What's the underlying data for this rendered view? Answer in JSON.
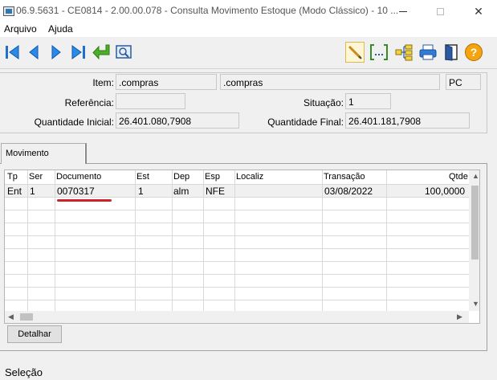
{
  "window": {
    "title": "06.9.5631 - CE0814 - 2.00.00.078 - Consulta Movimento Estoque (Modo Clássico) - 10 ...",
    "close_glyph": "✕"
  },
  "menu": [
    "Arquivo",
    "Ajuda"
  ],
  "toolbar": {
    "icons": [
      "first-icon",
      "previous-icon",
      "next-icon",
      "last-icon",
      "return-icon",
      "preview-icon",
      "pencil-icon",
      "range-icon",
      "tree-icon",
      "print-icon",
      "exit-icon",
      "help-icon"
    ],
    "help_glyph": "?"
  },
  "form": {
    "item_label": "Item:",
    "item_code": ".compras",
    "item_desc": ".compras",
    "item_unit": "PC",
    "referencia_label": "Referência:",
    "referencia_value": "",
    "situacao_label": "Situação:",
    "situacao_value": "1",
    "qtd_inicial_label": "Quantidade Inicial:",
    "qtd_inicial_value": "26.401.080,7908",
    "qtd_final_label": "Quantidade Final:",
    "qtd_final_value": "26.401.181,7908"
  },
  "tab": {
    "label": "Movimento"
  },
  "grid": {
    "columns": [
      "Tp",
      "Ser",
      "Documento",
      "Est",
      "Dep",
      "Esp",
      "Localiz",
      "Transação",
      "Qtde"
    ],
    "rows": [
      [
        "Ent",
        "1",
        "0070317",
        "1",
        "alm",
        "NFE",
        "",
        "03/08/2022",
        "100,0000"
      ]
    ]
  },
  "buttons": {
    "detalhar": "Detalhar"
  },
  "status": "Seleção"
}
